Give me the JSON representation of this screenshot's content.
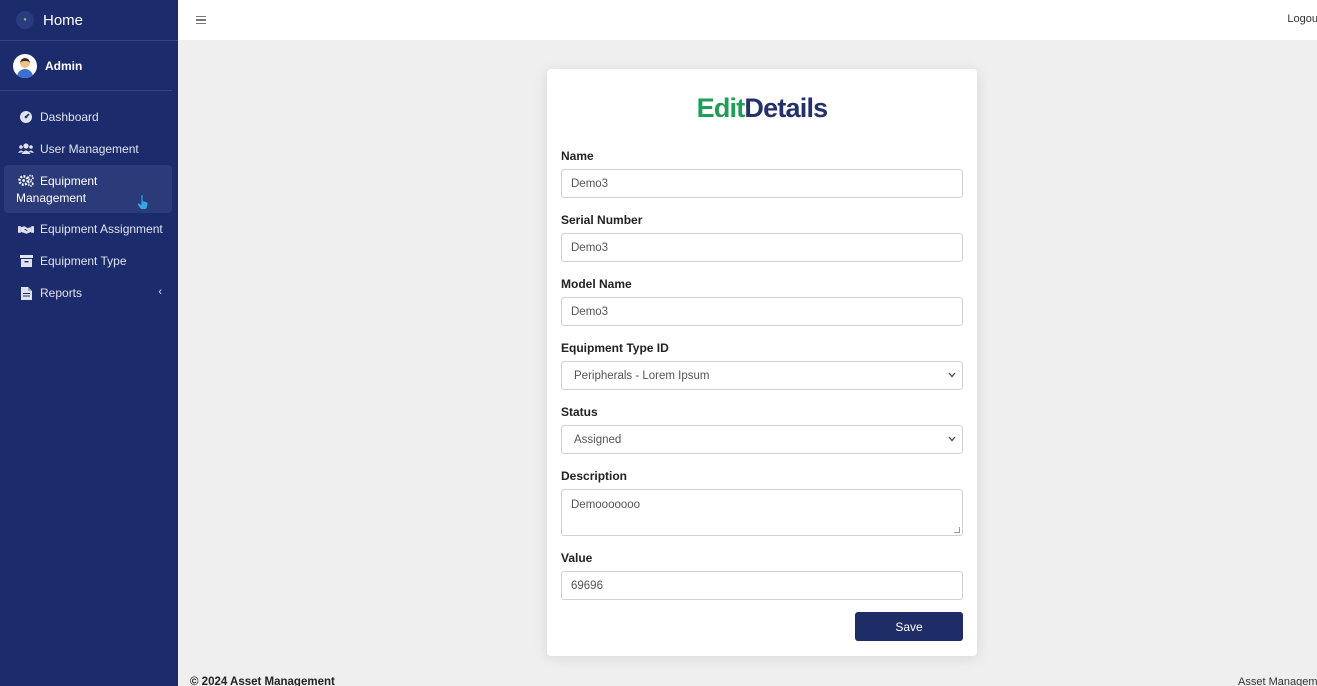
{
  "sidebar": {
    "brand": "Home",
    "user": "Admin",
    "items": [
      {
        "label": "Dashboard",
        "icon": "dashboard-icon"
      },
      {
        "label": "User Management",
        "icon": "users-icon"
      },
      {
        "label_line1": "Equipment",
        "label_line2": "Management",
        "icon": "gears-icon",
        "active": true
      },
      {
        "label": "Equipment Assignment",
        "icon": "handshake-icon"
      },
      {
        "label": "Equipment Type",
        "icon": "archive-icon"
      },
      {
        "label": "Reports",
        "icon": "file-icon",
        "caret": "‹"
      }
    ]
  },
  "topbar": {
    "menu_icon": "hamburger-icon",
    "logout": "Logout"
  },
  "form": {
    "title_part1": "Edit",
    "title_part2": "Details",
    "name": {
      "label": "Name",
      "value": "Demo3"
    },
    "serial": {
      "label": "Serial Number",
      "value": "Demo3"
    },
    "model": {
      "label": "Model Name",
      "value": "Demo3"
    },
    "type": {
      "label": "Equipment Type ID",
      "value": "Peripherals - Lorem Ipsum"
    },
    "status": {
      "label": "Status",
      "value": "Assigned"
    },
    "description": {
      "label": "Description",
      "value": "Demooooooo"
    },
    "value": {
      "label": "Value",
      "value": "69696"
    },
    "save": "Save"
  },
  "footer": {
    "copyright": "© 2024 Asset Management",
    "right": "Asset Management"
  },
  "colors": {
    "sidebar_bg": "#1c2b6b",
    "accent_green": "#1e9e58",
    "accent_navy": "#23306b",
    "button_bg": "#1f2d66"
  }
}
